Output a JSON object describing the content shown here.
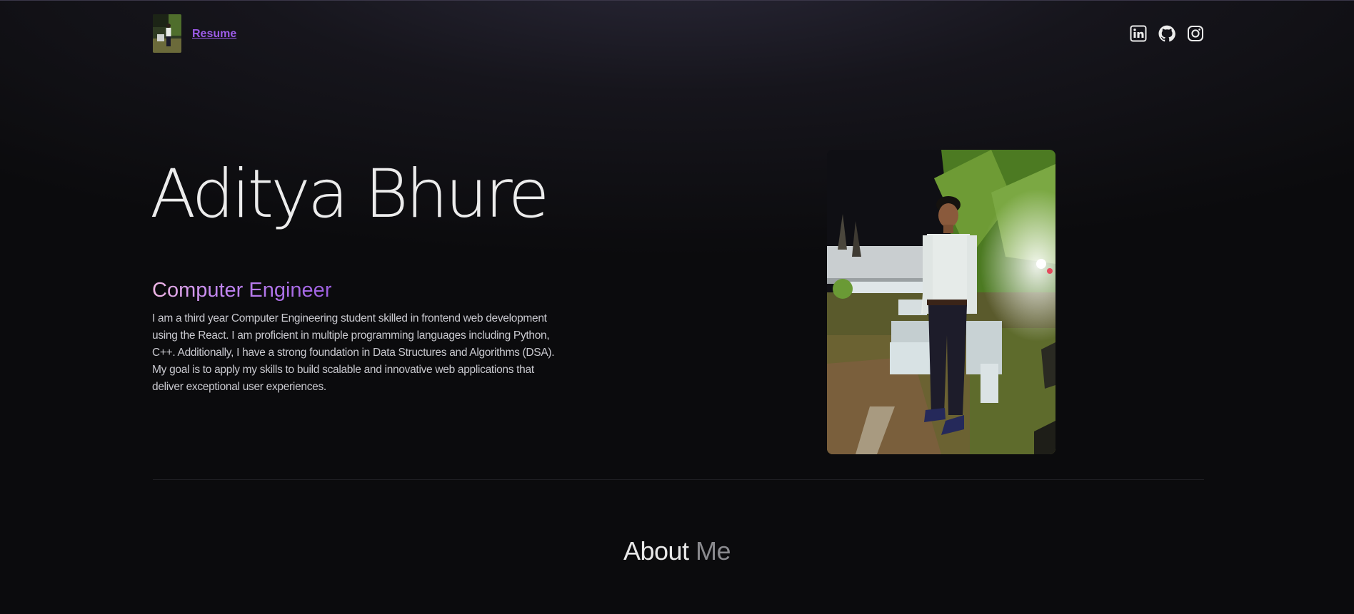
{
  "nav": {
    "resume_label": "Resume",
    "socials": [
      {
        "icon": "linkedin-icon"
      },
      {
        "icon": "github-icon"
      },
      {
        "icon": "instagram-icon"
      }
    ]
  },
  "hero": {
    "name": "Aditya Bhure",
    "role": "Computer Engineer",
    "bio": "I am a third year Computer Engineering student skilled in frontend web development using the React. I am proficient in multiple programming languages including Python, C++. Additionally, I have a strong foundation in Data Structures and Algorithms (DSA). My goal is to apply my skills to build scalable and innovative web applications that deliver exceptional user experiences."
  },
  "about": {
    "word1": "About",
    "word2": "Me"
  },
  "colors": {
    "accent": "#9c5be8",
    "role_gradient_start": "#f0b7e4",
    "role_gradient_end": "#9d5fe0",
    "background": "#0b0b0d"
  }
}
